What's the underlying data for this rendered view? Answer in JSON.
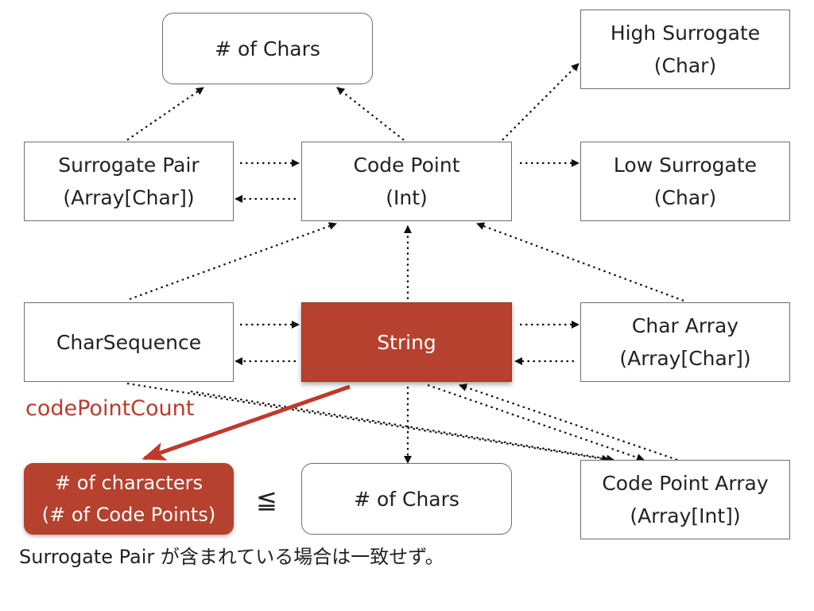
{
  "nodes": {
    "chars_top": {
      "lines": [
        "# of Chars"
      ]
    },
    "high_surrogate": {
      "lines": [
        "High Surrogate",
        "(Char)"
      ]
    },
    "surrogate_pair": {
      "lines": [
        "Surrogate Pair",
        "(Array[Char])"
      ]
    },
    "code_point": {
      "lines": [
        "Code Point",
        "(Int)"
      ]
    },
    "low_surrogate": {
      "lines": [
        "Low Surrogate",
        "(Char)"
      ]
    },
    "char_sequence": {
      "lines": [
        "CharSequence"
      ]
    },
    "string": {
      "lines": [
        "String"
      ]
    },
    "char_array": {
      "lines": [
        "Char Array",
        "(Array[Char])"
      ]
    },
    "characters": {
      "lines": [
        "# of characters",
        "(# of Code Points)"
      ]
    },
    "chars_bottom": {
      "lines": [
        "# of Chars"
      ]
    },
    "code_point_array": {
      "lines": [
        "Code Point Array",
        "(Array[Int])"
      ]
    }
  },
  "labels": {
    "method": "codePointCount",
    "relation": "≦",
    "note": "Surrogate Pair が含まれている場合は一致せず。"
  },
  "colors": {
    "accent": "#b5412e",
    "accent_text": "#c0392b",
    "border": "#6e6e6e",
    "connector": "#111111"
  }
}
